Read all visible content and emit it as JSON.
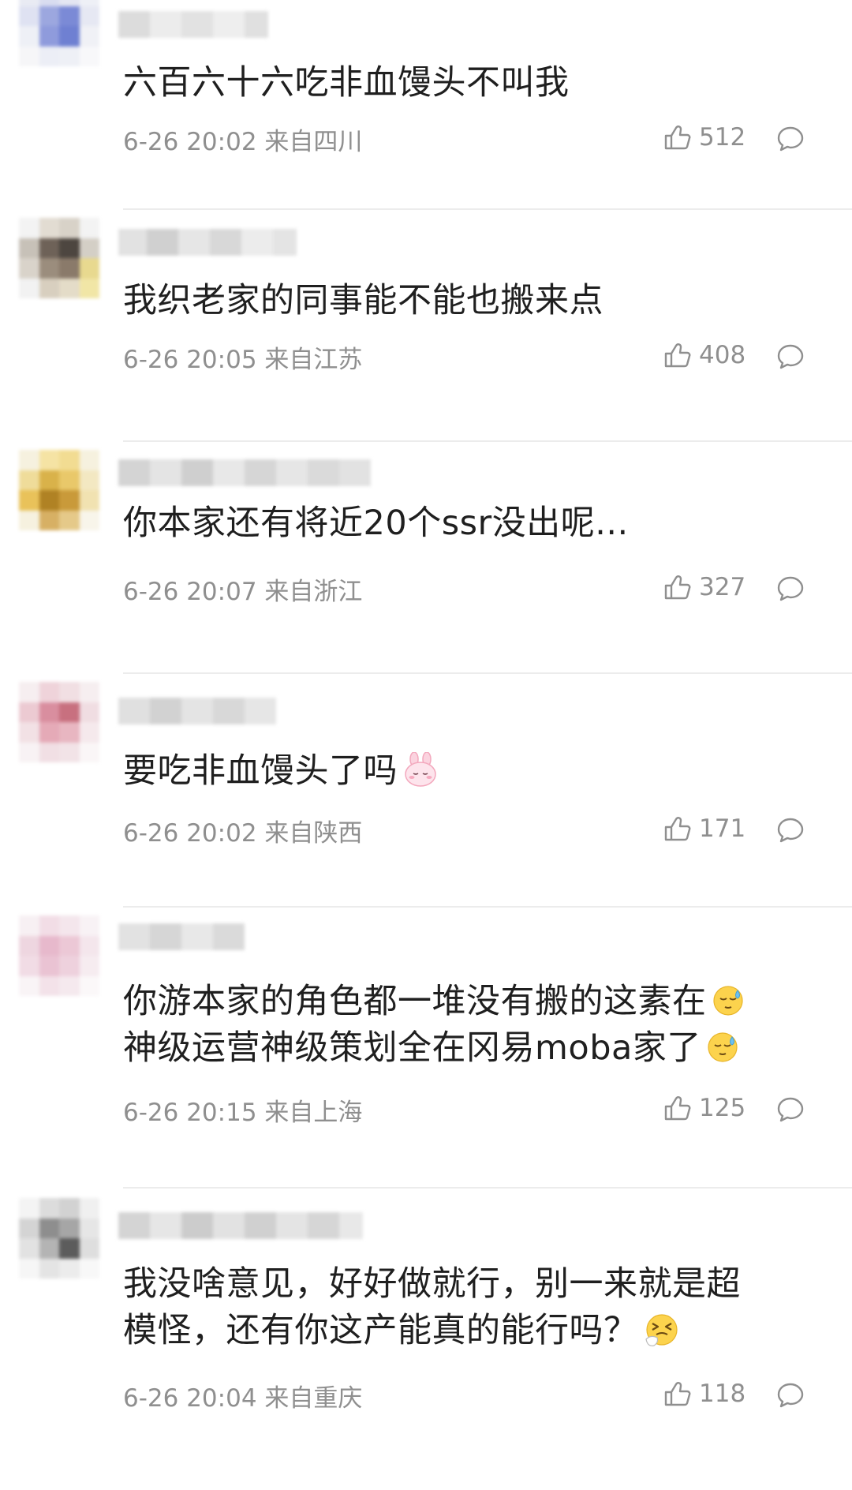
{
  "comments": [
    {
      "text_lines": [
        "六百六十六吃非血馒头不叫我"
      ],
      "date": "6-26 20:02",
      "location": "来自四川",
      "likes": "512"
    },
    {
      "text_lines": [
        "我织老家的同事能不能也搬来点"
      ],
      "date": "6-26 20:05",
      "location": "来自江苏",
      "likes": "408"
    },
    {
      "text_lines": [
        "你本家还有将近20个ssr没出呢..."
      ],
      "date": "6-26 20:07",
      "location": "来自浙江",
      "likes": "327"
    },
    {
      "text_lines": [
        "要吃非血馒头了吗"
      ],
      "date": "6-26 20:02",
      "location": "来自陕西",
      "likes": "171"
    },
    {
      "text_lines": [
        "你游本家的角色都一堆没有搬的这素在",
        "神级运营神级策划全在冈易moba家了"
      ],
      "date": "6-26 20:15",
      "location": "来自上海",
      "likes": "125"
    },
    {
      "text_lines": [
        "我没啥意见，好好做就行，别一来就是超",
        "模怪，还有你这产能真的能行吗？"
      ],
      "date": "6-26 20:04",
      "location": "来自重庆",
      "likes": "118"
    }
  ],
  "colors": {
    "text": "#1f1f1f",
    "meta": "#8f8f8f",
    "divider": "#ececec"
  },
  "icons": {
    "like": "thumbs-up-outline-icon",
    "reply": "speech-bubble-outline-icon",
    "emoji_bunny": "pink-bunny-emoji-icon",
    "emoji_sweat": "sweat-face-emoji-icon",
    "emoji_sneeze": "sneezing-face-emoji-icon"
  }
}
